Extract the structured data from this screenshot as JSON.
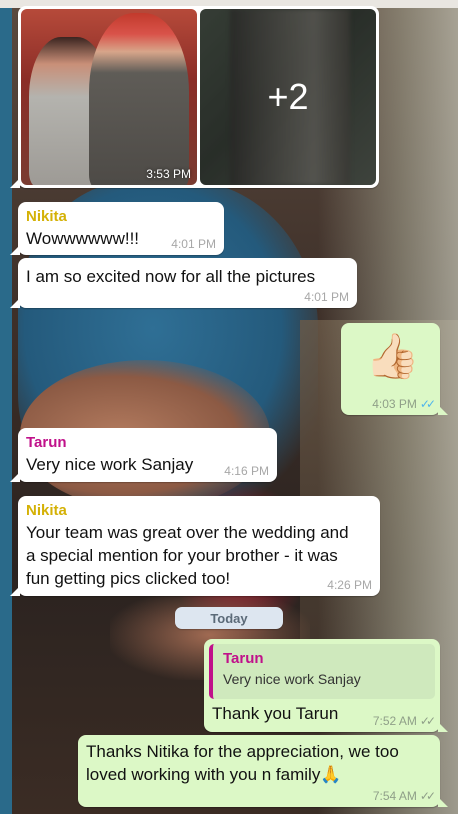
{
  "media": {
    "time": "3:53 PM",
    "more_count": "+2"
  },
  "messages": [
    {
      "sender": "Nikita",
      "text": "Wowwwwww!!!",
      "time": "4:01 PM"
    },
    {
      "text": "I am so excited now for all the pictures",
      "time": "4:01 PM"
    },
    {
      "emoji": "👍🏻",
      "time": "4:03 PM",
      "ticks": "✓✓"
    },
    {
      "sender": "Tarun",
      "text": "Very nice work Sanjay",
      "time": "4:16 PM"
    },
    {
      "sender": "Nikita",
      "lines": [
        "Your team was great over the wedding and",
        "a special mention for your brother - it was",
        "fun getting pics clicked too!"
      ],
      "time": "4:26 PM"
    }
  ],
  "date_divider": "Today",
  "reply": {
    "quote_sender": "Tarun",
    "quote_text": "Very nice work Sanjay",
    "text": "Thank you Tarun",
    "time": "7:52 AM",
    "ticks": "✓✓"
  },
  "last_message": {
    "lines": [
      "Thanks Nitika for the appreciation, we too",
      "loved working with you n family🙏"
    ],
    "time": "7:54 AM",
    "ticks": "✓✓"
  },
  "colors": {
    "nikita_name": "#d4b106",
    "tarun_name": "#c0118a",
    "incoming_bubble": "#ffffff",
    "outgoing_bubble": "#dcf8c6",
    "read_ticks": "#4fb5ec",
    "sent_ticks": "#8f9f88"
  }
}
